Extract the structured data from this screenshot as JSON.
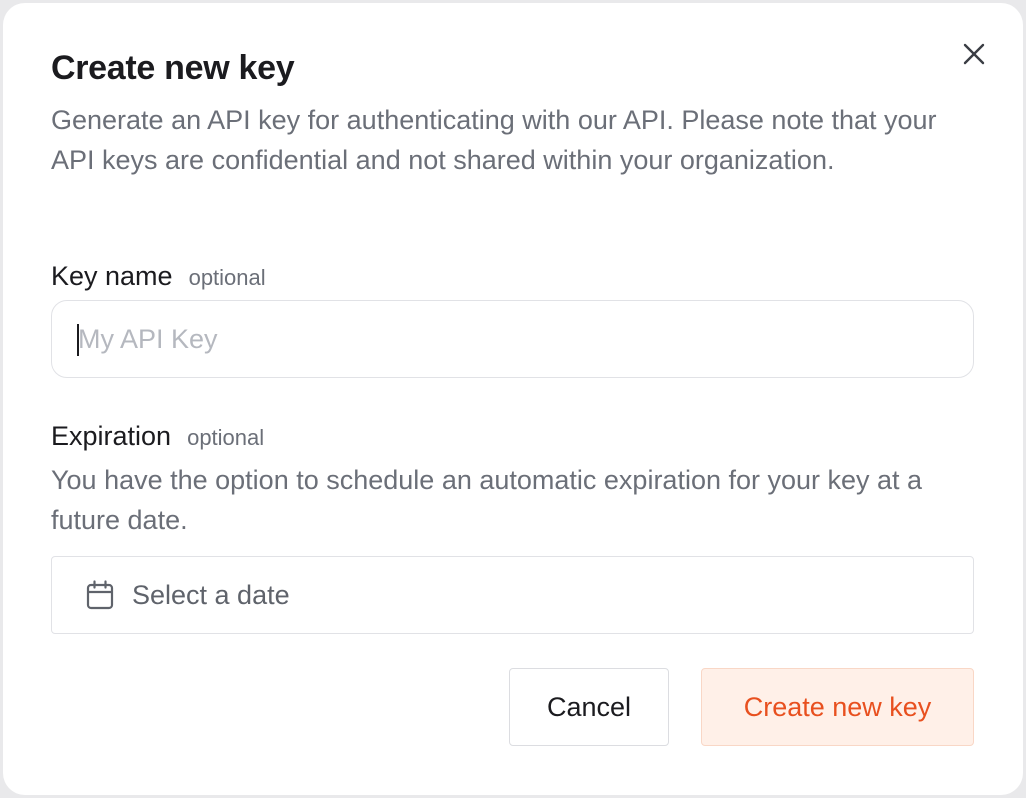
{
  "dialog": {
    "title": "Create new key",
    "description": "Generate an API key for authenticating with our API. Please note that your API keys are confidential and not shared within your organization.",
    "close_icon": "close-icon"
  },
  "key_name": {
    "label": "Key name",
    "optional": "optional",
    "value": "",
    "placeholder": "My API Key"
  },
  "expiration": {
    "label": "Expiration",
    "optional": "optional",
    "description": "You have the option to schedule an automatic expiration for your key at a future date.",
    "date_placeholder": "Select a date",
    "icon": "calendar-icon"
  },
  "actions": {
    "cancel_label": "Cancel",
    "create_label": "Create new key"
  },
  "colors": {
    "accent": "#e8501f",
    "accent_bg": "#fff0e8",
    "text_primary": "#1b1b1f",
    "text_secondary": "#6b6f78"
  }
}
